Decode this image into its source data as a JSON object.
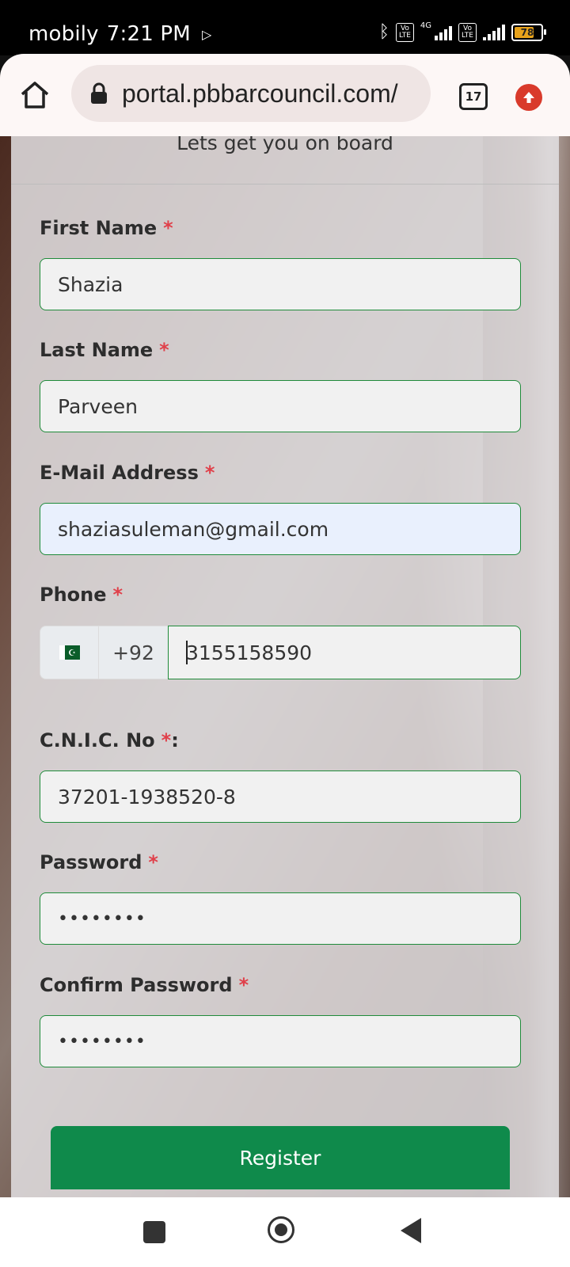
{
  "status_bar": {
    "carrier": "mobily",
    "time": "7:21 PM",
    "network": "4G",
    "battery": "78"
  },
  "browser": {
    "url": "portal.pbbarcouncil.com/",
    "tab_count": "17"
  },
  "form": {
    "subtitle": "Lets get you on board",
    "first_name": {
      "label": "First Name",
      "required_mark": "*",
      "value": "Shazia"
    },
    "last_name": {
      "label": "Last Name",
      "required_mark": "*",
      "value": "Parveen"
    },
    "email": {
      "label": "E-Mail Address",
      "required_mark": "*",
      "value": "shaziasuleman@gmail.com"
    },
    "phone": {
      "label": "Phone",
      "required_mark": "*",
      "country_code": "+92",
      "value": "3155158590",
      "flag": "pakistan-flag"
    },
    "cnic": {
      "label": "C.N.I.C. No",
      "required_mark": "*",
      "suffix": ":",
      "value": "37201-1938520-8"
    },
    "password": {
      "label": "Password",
      "required_mark": "*",
      "value": "••••••••"
    },
    "confirm_password": {
      "label": "Confirm Password",
      "required_mark": "*",
      "value": "••••••••"
    },
    "submit_label": "Register"
  },
  "colors": {
    "input_border": "#1f8b3a",
    "register_button": "#0f8a4b",
    "required": "#e0404a",
    "update_badge": "#d93a2b"
  }
}
